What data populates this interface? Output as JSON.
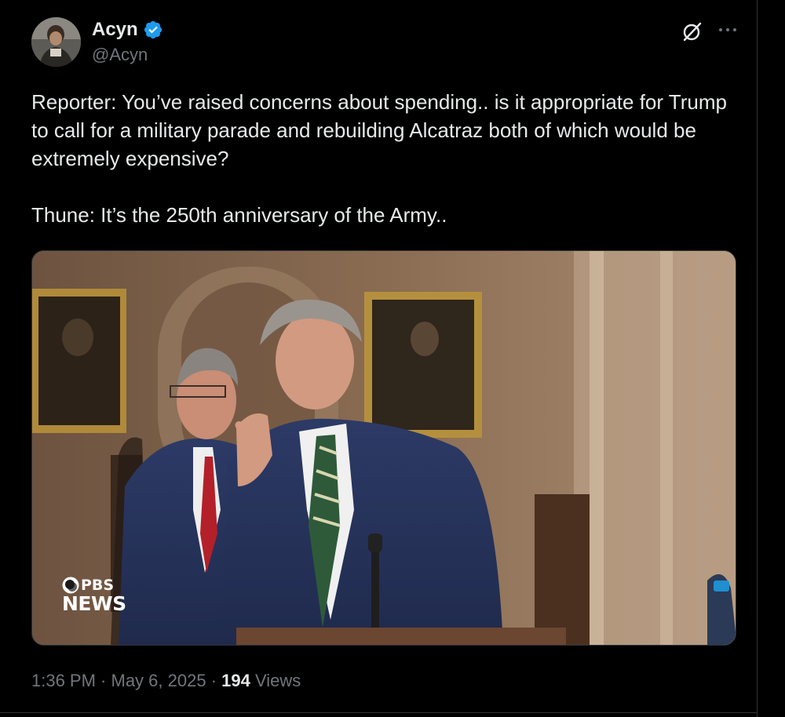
{
  "author": {
    "display_name": "Acyn",
    "handle": "@Acyn",
    "verified": true,
    "verified_color": "#1d9bf0"
  },
  "icons": {
    "avatar": "avatar-photo",
    "verified": "verified-badge-icon",
    "grok": "grok-icon",
    "more": "more-options-icon"
  },
  "tweet": {
    "paragraphs": [
      "Reporter: You’ve raised concerns about spending.. is it appropriate for Trump to call for a military parade and rebuilding Alcatraz both of which would be extremely expensive?",
      "Thune: It’s the 250th anniversary of the Army.."
    ]
  },
  "media": {
    "type": "video-thumbnail",
    "watermark_top": "PBS",
    "watermark_bottom": "NEWS"
  },
  "meta": {
    "time": "1:36 PM",
    "separator": " · ",
    "date": "May 6, 2025",
    "views_count": "194",
    "views_label": " Views"
  },
  "colors": {
    "background": "#000000",
    "text_primary": "#e7e9ea",
    "text_secondary": "#71767b",
    "border": "#2f3336"
  }
}
